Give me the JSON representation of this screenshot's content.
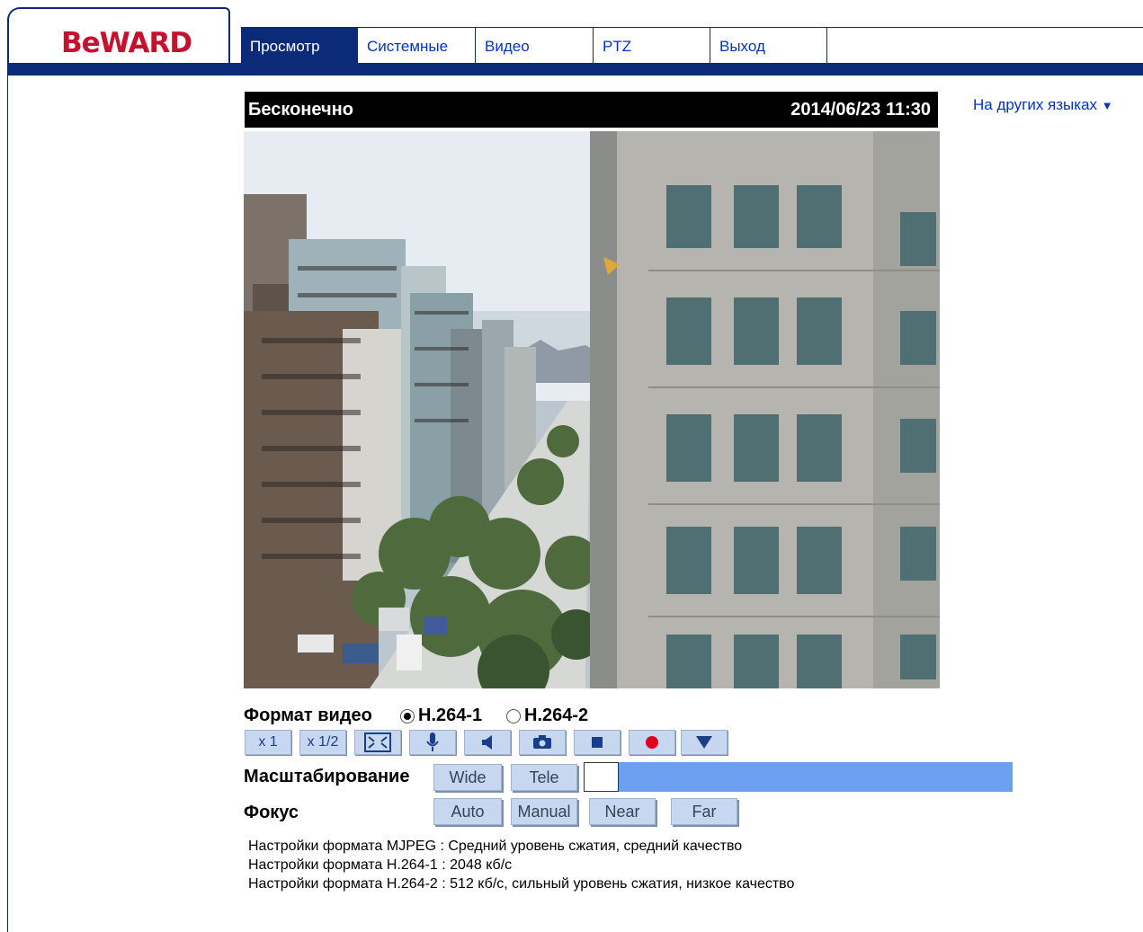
{
  "brand": {
    "logo_text": "BeWARD",
    "color": "#c8102e"
  },
  "nav": {
    "tabs": [
      {
        "label": "Просмотр",
        "active": true
      },
      {
        "label": "Системные"
      },
      {
        "label": "Видео"
      },
      {
        "label": "PTZ"
      },
      {
        "label": "Выход"
      }
    ]
  },
  "language": {
    "label": "На других языках",
    "icon": "triangle-down-icon"
  },
  "camera": {
    "title": "Бесконечно",
    "datetime": "2014/06/23 11:30"
  },
  "video_format": {
    "label": "Формат видео",
    "options": [
      {
        "label": "H.264-1",
        "selected": true
      },
      {
        "label": "H.264-2",
        "selected": false
      }
    ]
  },
  "toolbar": {
    "zoom_1x": "x 1",
    "zoom_half": "x 1/2",
    "icons": [
      "fullscreen-icon",
      "microphone-icon",
      "speaker-icon",
      "snapshot-camera-icon",
      "stop-icon",
      "record-icon",
      "more-down-icon"
    ]
  },
  "zoom": {
    "label": "Масштабирование",
    "wide": "Wide",
    "tele": "Tele"
  },
  "focus": {
    "label": "Фокус",
    "auto": "Auto",
    "manual": "Manual",
    "near": "Near",
    "far": "Far"
  },
  "info_lines": [
    "Настройки формата MJPEG : Средний уровень сжатия, средний качество",
    "Настройки формата H.264-1 : 2048 кб/с",
    "Настройки формата H.264-2 : 512 кб/с, сильный уровень сжатия, низкое качество"
  ],
  "colors": {
    "navy": "#0b2a78",
    "link_blue": "#0033cc",
    "button_bg": "#c6d7ef",
    "zoom_bar": "#6c9ff0"
  }
}
